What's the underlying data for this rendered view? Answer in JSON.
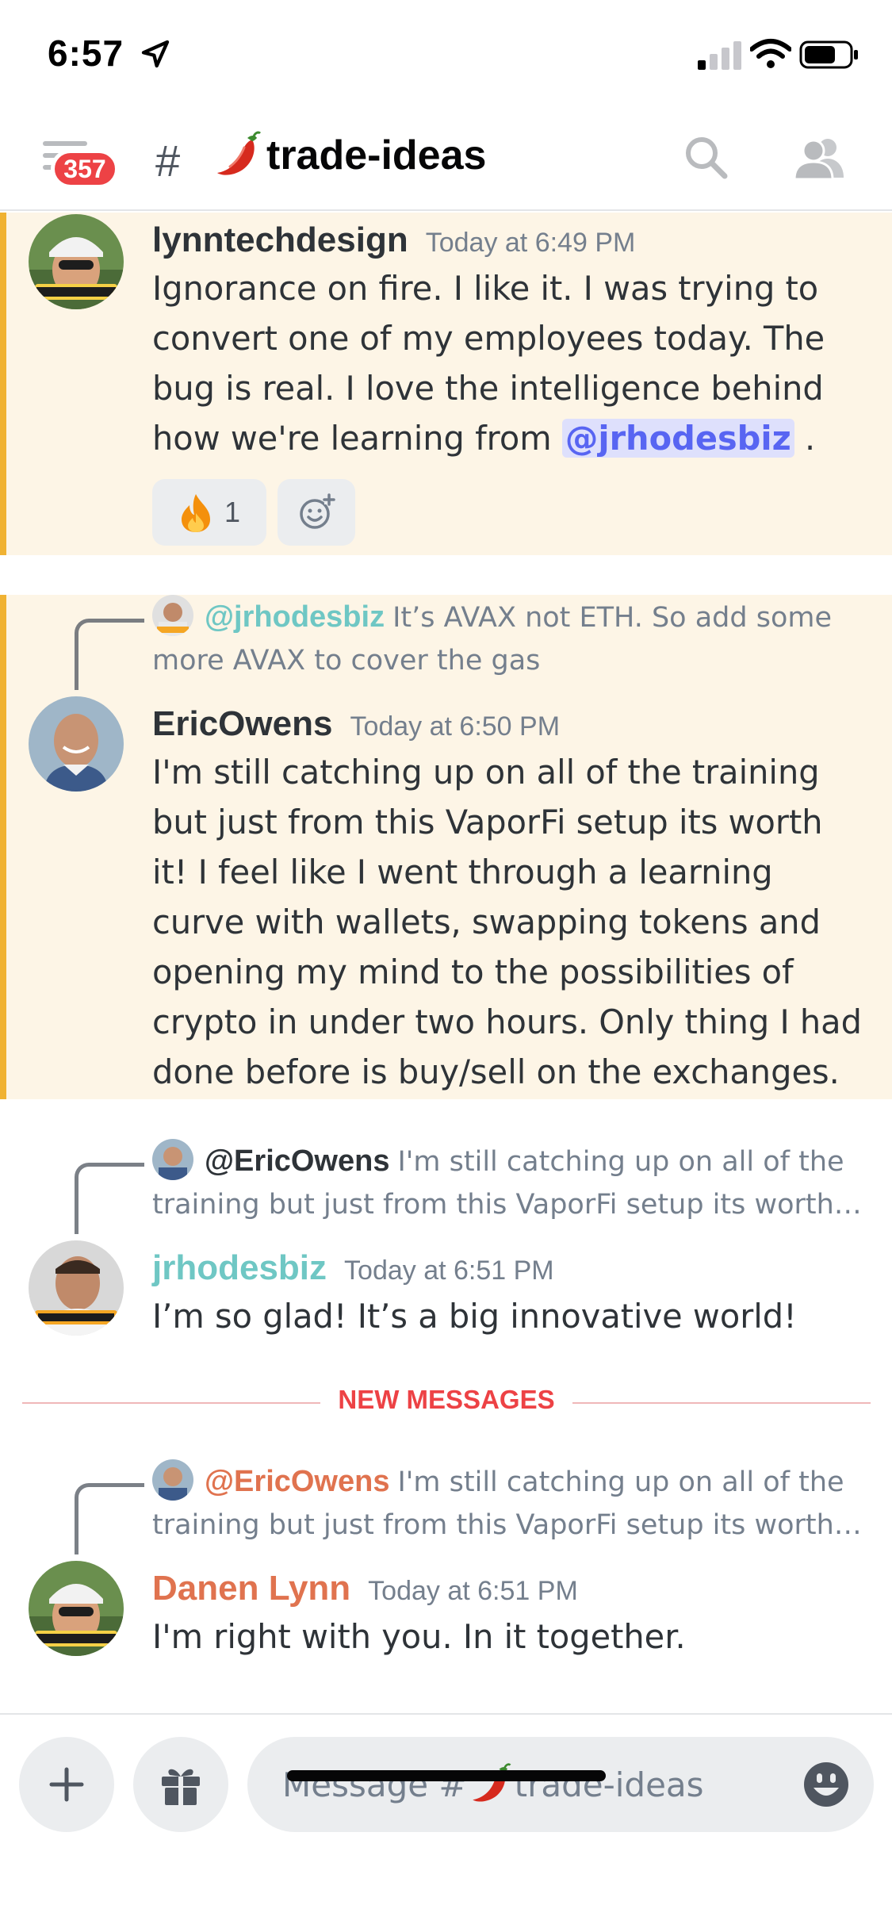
{
  "status_bar": {
    "time": "6:57"
  },
  "header": {
    "unread_badge": "357",
    "channel_name": "trade-ideas"
  },
  "messages": [
    {
      "author": "lynntechdesign",
      "timestamp": "Today at 6:49 PM",
      "text_before": "Ignorance on fire. I like it. I was trying to convert one of my employees today. The bug is real. I love the intelligence behind how we're learning from ",
      "mention": "@jrhodesbiz",
      "text_after": " .",
      "reaction_count": "1",
      "highlighted": true
    },
    {
      "reply_to": "@jrhodesbiz",
      "reply_text_line1": "It’s AVAX not ETH. So add some",
      "reply_text_line2": "more AVAX to cover the gas",
      "author": "EricOwens",
      "timestamp": "Today at 6:50 PM",
      "text": "I'm still catching up on all of the training but just from this VaporFi setup its worth it! I feel like I went through a learning curve with wallets, swapping tokens and opening my mind to the possibilities of crypto in under two hours.  Only thing I had done before is buy/sell on the exchanges.",
      "highlighted": true
    },
    {
      "reply_to": "@EricOwens",
      "reply_text_line1": "I'm still catching up on all of the",
      "reply_text_line2": "training but just from this VaporFi setup its worth…",
      "author": "jrhodesbiz",
      "author_color": "#6fc7c4",
      "timestamp": "Today at 6:51 PM",
      "text": "I’m so glad! It’s a big innovative world!"
    },
    {
      "reply_to": "@EricOwens",
      "reply_text_line1": "I'm still catching up on all of the",
      "reply_text_line2": "training but just from this VaporFi setup its worth…",
      "author": "Danen Lynn",
      "author_color": "#e0734f",
      "timestamp": "Today at 6:51 PM",
      "text": "I'm right with you. In it together."
    }
  ],
  "divider_label": "NEW MESSAGES",
  "composer": {
    "placeholder": "Message #",
    "channel": "trade-ideas"
  },
  "colors": {
    "highlight_bg": "#fdf5e6",
    "highlight_bar": "#f0b232",
    "mention": "#5865f2",
    "new_messages": "#ed4245",
    "jrhodesbiz": "#6fc7c4",
    "danen": "#e0734f"
  },
  "icons": [
    "location-arrow-icon",
    "signal-icon",
    "wifi-icon",
    "battery-icon",
    "menu-icon",
    "hash-icon",
    "pepper-icon",
    "search-icon",
    "members-icon",
    "fire-icon",
    "add-reaction-icon",
    "plus-icon",
    "gift-icon",
    "emoji-icon"
  ]
}
